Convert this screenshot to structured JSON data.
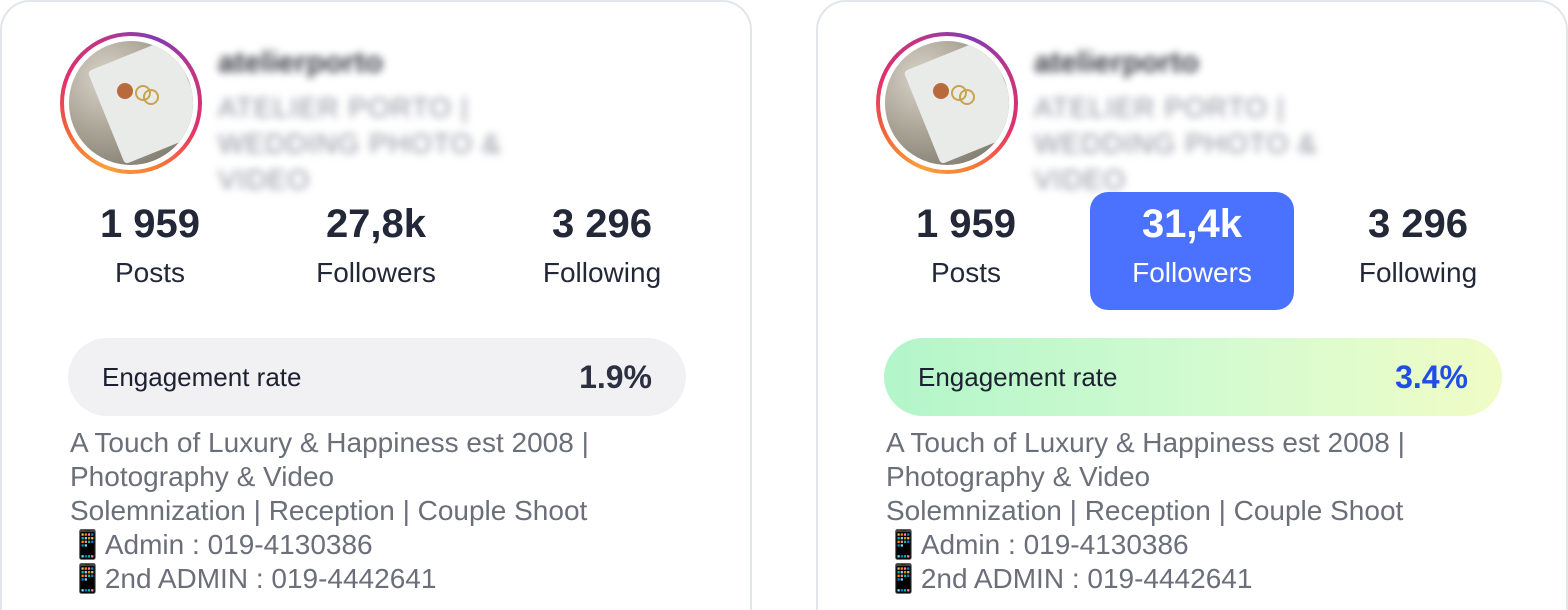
{
  "cards": [
    {
      "username": "atelierporto",
      "full_name": "ATELIER PORTO | WEDDING PHOTO & VIDEO",
      "stats": {
        "posts": {
          "value": "1 959",
          "label": "Posts"
        },
        "followers": {
          "value": "27,8k",
          "label": "Followers"
        },
        "following": {
          "value": "3 296",
          "label": "Following"
        }
      },
      "engagement": {
        "label": "Engagement rate",
        "value": "1.9%"
      },
      "bio": [
        "A Touch of Luxury & Happiness est 2008 |",
        "Photography & Video",
        "Solemnization | Reception | Couple Shoot",
        "📱Admin : 019-4130386",
        "📱2nd ADMIN : 019-4442641"
      ]
    },
    {
      "username": "atelierporto",
      "full_name": "ATELIER PORTO | WEDDING PHOTO & VIDEO",
      "stats": {
        "posts": {
          "value": "1 959",
          "label": "Posts"
        },
        "followers": {
          "value": "31,4k",
          "label": "Followers"
        },
        "following": {
          "value": "3 296",
          "label": "Following"
        }
      },
      "engagement": {
        "label": "Engagement rate",
        "value": "3.4%"
      },
      "bio": [
        "A Touch of Luxury & Happiness est 2008 |",
        "Photography & Video",
        "Solemnization | Reception | Couple Shoot",
        "📱Admin : 019-4130386",
        "📱2nd ADMIN : 019-4442641"
      ]
    }
  ],
  "colors": {
    "highlight_blue": "#4a72ff",
    "engagement_value_blue": "#1f4de8",
    "engagement_good_gradient": [
      "#b2f6c9",
      "#f0fcc6"
    ],
    "engagement_neutral": "#f1f1f3"
  },
  "icons": {
    "avatar_ring": "instagram-story-ring",
    "phone_emoji": "mobile-phone-icon"
  }
}
